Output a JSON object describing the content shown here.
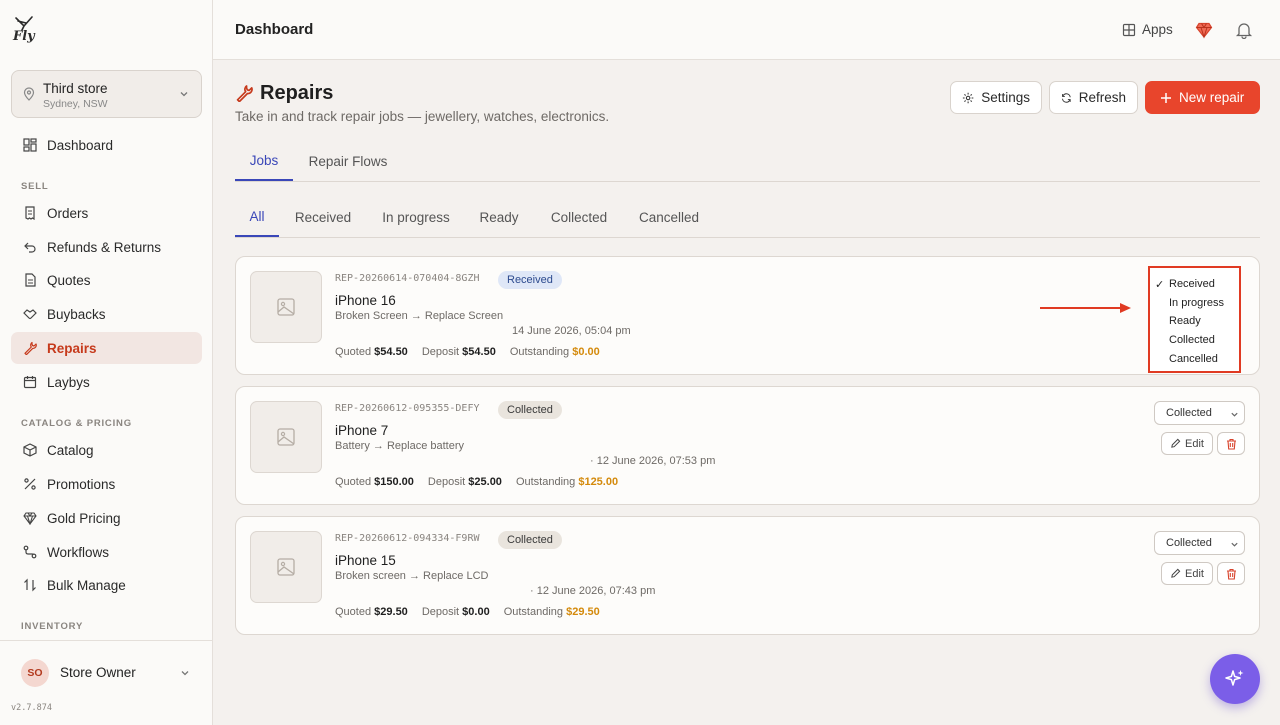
{
  "sidebar": {
    "logo_text": "Fly",
    "store": {
      "name": "Third store",
      "location": "Sydney, NSW"
    },
    "items": {
      "dashboard": "Dashboard",
      "sell_section": "SELL",
      "orders": "Orders",
      "refunds": "Refunds & Returns",
      "quotes": "Quotes",
      "buybacks": "Buybacks",
      "repairs": "Repairs",
      "laybys": "Laybys",
      "catalog_section": "CATALOG & PRICING",
      "catalog": "Catalog",
      "promotions": "Promotions",
      "gold_pricing": "Gold Pricing",
      "workflows": "Workflows",
      "bulk_manage": "Bulk Manage",
      "inventory_section": "INVENTORY"
    },
    "user": {
      "initials": "SO",
      "name": "Store Owner"
    },
    "version": "v2.7.874"
  },
  "header": {
    "title": "Dashboard",
    "apps_label": "Apps"
  },
  "page": {
    "title": "Repairs",
    "subtitle": "Take in and track repair jobs — jewellery, watches, electronics.",
    "settings_label": "Settings",
    "refresh_label": "Refresh",
    "new_repair_label": "New repair",
    "tabs": [
      "Jobs",
      "Repair Flows"
    ],
    "filters": [
      "All",
      "Received",
      "In progress",
      "Ready",
      "Collected",
      "Cancelled"
    ]
  },
  "labels": {
    "quoted": "Quoted",
    "deposit": "Deposit",
    "outstanding": "Outstanding",
    "edit": "Edit"
  },
  "jobs": [
    {
      "ref": "REP-20260614-070404-8GZH",
      "status": "Received",
      "device": "iPhone 16",
      "issue": "Broken Screen → Replace Screen",
      "date": "14 June 2026, 05:04 pm",
      "quoted": "$54.50",
      "deposit": "$54.50",
      "outstanding": "$0.00"
    },
    {
      "ref": "REP-20260612-095355-DEFY",
      "status": "Collected",
      "device": "iPhone 7",
      "issue": "Battery → Replace battery",
      "date": "· 12 June 2026, 07:53 pm",
      "quoted": "$150.00",
      "deposit": "$25.00",
      "outstanding": "$125.00",
      "select_value": "Collected"
    },
    {
      "ref": "REP-20260612-094334-F9RW",
      "status": "Collected",
      "device": "iPhone 15",
      "issue": "Broken screen → Replace LCD",
      "date": "· 12 June 2026, 07:43 pm",
      "quoted": "$29.50",
      "deposit": "$0.00",
      "outstanding": "$29.50",
      "select_value": "Collected"
    }
  ],
  "dropdown": {
    "selected": "Received",
    "check": "✓",
    "options": [
      "Received",
      "In progress",
      "Ready",
      "Collected",
      "Cancelled"
    ]
  },
  "colors": {
    "accent": "#e8452c",
    "tab_active": "#3a47b8",
    "outstanding": "#d48a0c",
    "fab": "#7b5ee8"
  }
}
